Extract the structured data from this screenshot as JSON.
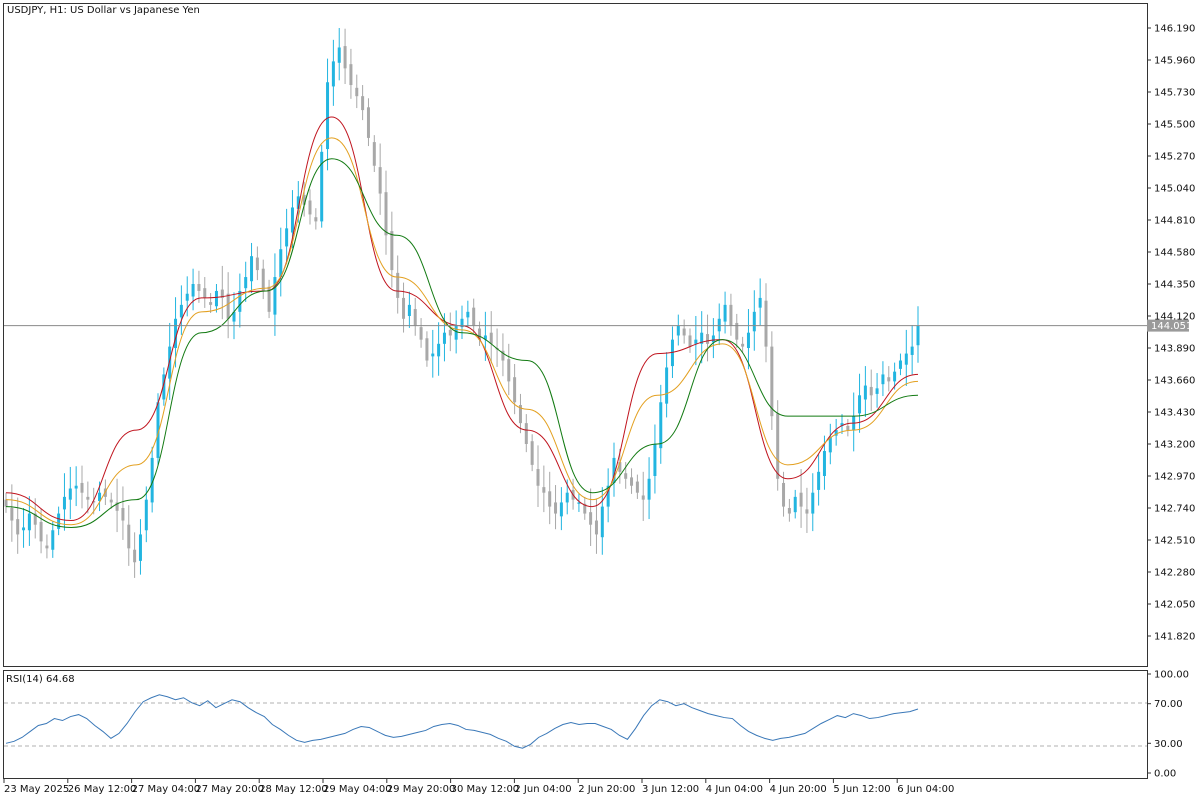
{
  "header": {
    "symbol_title": "USDJPY, H1:  US Dollar vs Japanese Yen",
    "rsi_label": "RSI(14) 64.68"
  },
  "price_panel": {
    "current_price": "144.051",
    "price_ticks": [
      "146.190",
      "145.960",
      "145.730",
      "145.500",
      "145.270",
      "145.040",
      "144.810",
      "144.580",
      "144.350",
      "144.120",
      "143.890",
      "143.660",
      "143.430",
      "143.200",
      "142.970",
      "142.740",
      "142.510",
      "142.280",
      "142.050",
      "141.820"
    ]
  },
  "rsi_panel": {
    "ticks": [
      "100.00",
      "70.00",
      "30.00",
      "0.00"
    ],
    "levels": [
      70,
      30
    ],
    "value": 64.68
  },
  "time_axis": {
    "labels": [
      "23 May 2025",
      "26 May 12:00",
      "27 May 04:00",
      "27 May 20:00",
      "28 May 12:00",
      "29 May 04:00",
      "29 May 20:00",
      "30 May 12:00",
      "2 Jun 04:00",
      "2 Jun 20:00",
      "3 Jun 12:00",
      "4 Jun 04:00",
      "4 Jun 20:00",
      "5 Jun 12:00",
      "6 Jun 04:00"
    ]
  },
  "colors": {
    "bull": "#22b5e0",
    "bear": "#a8a8a8",
    "ma_fast": "#c0141e",
    "ma_mid": "#e3a020",
    "ma_slow": "#127a12",
    "rsi_line": "#3a78b8",
    "price_line": "#888888",
    "grid_border": "#444444"
  },
  "chart_data": {
    "type": "candlestick",
    "symbol": "USDJPY",
    "timeframe": "H1",
    "title": "USDJPY, H1:  US Dollar vs Japanese Yen",
    "ylim": [
      141.7,
      146.38
    ],
    "current_price": 144.051,
    "x_tick_labels": [
      "23 May 2025",
      "26 May 12:00",
      "27 May 04:00",
      "27 May 20:00",
      "28 May 12:00",
      "29 May 04:00",
      "29 May 20:00",
      "30 May 12:00",
      "2 Jun 04:00",
      "2 Jun 20:00",
      "3 Jun 12:00",
      "4 Jun 04:00",
      "4 Jun 20:00",
      "5 Jun 12:00",
      "6 Jun 04:00"
    ],
    "close_path": [
      142.75,
      142.65,
      142.55,
      142.6,
      142.7,
      142.62,
      142.5,
      142.45,
      142.58,
      142.7,
      142.82,
      142.88,
      142.9,
      142.85,
      142.8,
      142.78,
      142.85,
      142.82,
      142.78,
      142.72,
      142.65,
      142.45,
      142.35,
      142.55,
      142.8,
      143.1,
      143.5,
      143.7,
      143.9,
      144.1,
      144.2,
      144.28,
      144.35,
      144.3,
      144.25,
      144.2,
      144.3,
      144.25,
      144.1,
      144.15,
      144.3,
      144.4,
      144.55,
      144.45,
      144.3,
      144.15,
      144.4,
      144.6,
      144.75,
      144.9,
      144.98,
      144.92,
      144.85,
      144.8,
      145.3,
      145.8,
      145.95,
      146.05,
      145.9,
      145.78,
      145.7,
      145.6,
      145.4,
      145.2,
      145.0,
      144.7,
      144.45,
      144.25,
      144.1,
      144.2,
      144.05,
      143.95,
      143.8,
      143.85,
      143.92,
      144.0,
      143.98,
      144.05,
      144.1,
      144.15,
      144.05,
      143.95,
      143.98,
      143.92,
      143.88,
      143.8,
      143.65,
      143.5,
      143.35,
      143.2,
      143.05,
      142.9,
      142.85,
      142.75,
      142.7,
      142.78,
      142.85,
      142.8,
      142.78,
      142.7,
      142.62,
      142.55,
      142.75,
      142.9,
      143.1,
      143.0,
      142.95,
      142.9,
      142.85,
      142.8,
      142.95,
      143.2,
      143.5,
      143.75,
      143.95,
      144.05,
      143.98,
      143.9,
      143.95,
      144.0,
      143.92,
      143.98,
      144.1,
      144.2,
      144.05,
      143.95,
      143.9,
      144.0,
      144.15,
      144.25,
      143.9,
      143.4,
      142.95,
      142.75,
      142.7,
      142.82,
      142.75,
      142.7,
      142.85,
      143.0,
      143.15,
      143.25,
      143.3,
      143.35,
      143.3,
      143.4,
      143.55,
      143.62,
      143.55,
      143.6,
      143.7,
      143.65,
      143.72,
      143.8,
      143.85,
      143.9,
      144.05
    ],
    "series": [
      {
        "name": "MA (red)",
        "values": [
          142.85,
          142.65,
          143.3,
          144.25,
          144.3,
          145.55,
          144.3,
          144.05,
          143.3,
          142.75,
          143.85,
          143.95,
          142.95,
          143.35,
          143.7
        ]
      },
      {
        "name": "MA (orange)",
        "values": [
          142.8,
          142.62,
          143.05,
          144.15,
          144.32,
          145.4,
          144.4,
          144.02,
          143.45,
          142.8,
          143.55,
          143.92,
          143.05,
          143.3,
          143.65
        ]
      },
      {
        "name": "MA (green)",
        "values": [
          142.75,
          142.6,
          142.8,
          144.0,
          144.3,
          145.25,
          144.7,
          144.0,
          143.8,
          142.85,
          143.2,
          143.95,
          143.4,
          143.4,
          143.55
        ]
      }
    ],
    "rsi": {
      "name": "RSI(14)",
      "last": 64.68,
      "levels": [
        70,
        30
      ],
      "ylim": [
        0,
        100
      ],
      "values": [
        30,
        32,
        36,
        42,
        48,
        50,
        55,
        53,
        57,
        59,
        55,
        48,
        42,
        35,
        40,
        50,
        62,
        72,
        76,
        79,
        77,
        74,
        76,
        71,
        68,
        73,
        66,
        70,
        74,
        72,
        66,
        61,
        57,
        49,
        44,
        38,
        33,
        31,
        33,
        34,
        36,
        38,
        40,
        44,
        47,
        46,
        42,
        38,
        36,
        37,
        39,
        41,
        43,
        47,
        49,
        50,
        48,
        44,
        43,
        41,
        39,
        35,
        32,
        27,
        25,
        29,
        36,
        40,
        45,
        49,
        51,
        49,
        50,
        50,
        47,
        44,
        38,
        34,
        45,
        58,
        68,
        74,
        72,
        68,
        70,
        66,
        63,
        60,
        58,
        56,
        55,
        48,
        42,
        38,
        35,
        33,
        35,
        36,
        38,
        40,
        45,
        50,
        54,
        58,
        56,
        60,
        58,
        55,
        56,
        58,
        60,
        61,
        62,
        64.68
      ]
    }
  }
}
